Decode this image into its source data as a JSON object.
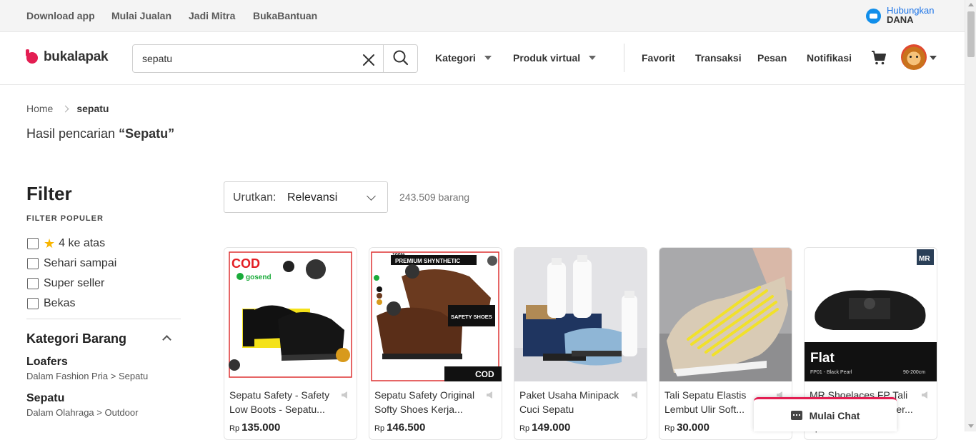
{
  "topbar": {
    "links": [
      "Download app",
      "Mulai Jualan",
      "Jadi Mitra",
      "BukaBantuan"
    ],
    "dana_line1": "Hubungkan",
    "dana_line2": "DANA"
  },
  "header": {
    "logo_text": "bukalapak",
    "search_value": "sepatu",
    "nav": {
      "kategori": "Kategori",
      "produk_virtual": "Produk virtual",
      "favorit": "Favorit",
      "transaksi": "Transaksi",
      "pesan": "Pesan",
      "notifikasi": "Notifikasi"
    },
    "icons": [
      "close-icon",
      "search-icon",
      "cart-icon",
      "avatar"
    ]
  },
  "breadcrumb": {
    "home": "Home",
    "current": "sepatu"
  },
  "result": {
    "prefix": "Hasil pencarian ",
    "query": "“Sepatu”"
  },
  "filter": {
    "title": "Filter",
    "popular_label": "FILTER POPULER",
    "options": [
      "4 ke atas",
      "Sehari sampai",
      "Super seller",
      "Bekas"
    ],
    "kategori_title": "Kategori Barang",
    "kategori": [
      {
        "name": "Loafers",
        "path": "Dalam Fashion Pria > Sepatu"
      },
      {
        "name": "Sepatu",
        "path": "Dalam Olahraga > Outdoor"
      }
    ]
  },
  "sort": {
    "label": "Urutkan:",
    "value": "Relevansi",
    "count": "243.509 barang"
  },
  "products": [
    {
      "title": "Sepatu Safety - Safety Low Boots - Sepatu...",
      "currency": "Rp",
      "price": "135.000",
      "badge": "COD",
      "brand": "gosend"
    },
    {
      "title": "Sepatu Safety Original Softy Shoes Kerja...",
      "currency": "Rp",
      "price": "146.500",
      "badge": "COD",
      "banner": "PREMIUM SHYNTHETIC",
      "percent": "100%",
      "label": "SAFETY SHOES"
    },
    {
      "title": "Paket Usaha Minipack Cuci Sepatu",
      "currency": "Rp",
      "price": "149.000"
    },
    {
      "title": "Tali Sepatu Elastis Lembut Ulir Soft...",
      "currency": "Rp",
      "price": "30.000"
    },
    {
      "title": "MR Shoelaces FP Tali Sepatu Flat Polyester...",
      "currency": "Rp",
      "price": "",
      "logo": "MR",
      "flat": "Flat",
      "sub": "FP01 - Black Pearl",
      "size": "90-200cm"
    }
  ],
  "chat": {
    "label": "Mulai Chat"
  },
  "colors": {
    "brand": "#e31e52",
    "dana": "#118eea"
  }
}
